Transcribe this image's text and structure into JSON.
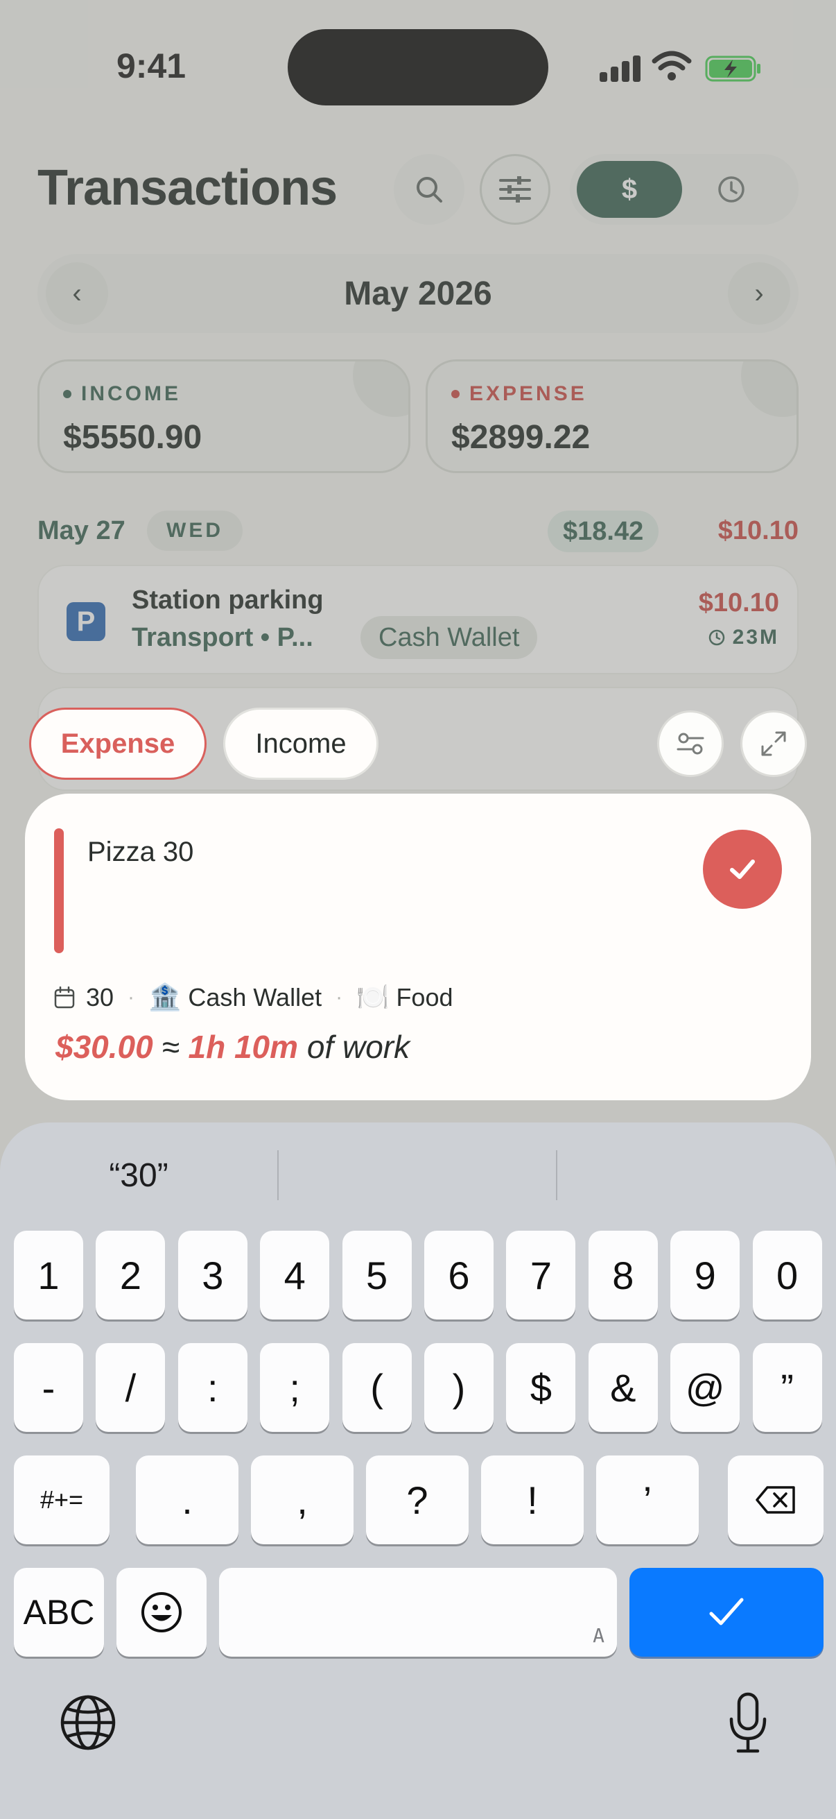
{
  "status_bar": {
    "time": "9:41"
  },
  "header": {
    "title": "Transactions",
    "currency_symbol": "$"
  },
  "month_nav": {
    "label": "May 2026",
    "prev": "‹",
    "next": "›"
  },
  "summary": {
    "income": {
      "label": "INCOME",
      "value": "$5550.90",
      "color": "#2f5b4b"
    },
    "expense": {
      "label": "EXPENSE",
      "value": "$2899.22",
      "color": "#c8423d"
    }
  },
  "day_group": {
    "date": "May 27",
    "weekday": "WED",
    "income_total": "$18.42",
    "expense_total": "$10.10"
  },
  "transactions": [
    {
      "icon_letter": "P",
      "title": "Station parking",
      "subtitle": "Transport • P...",
      "wallet": "Cash Wallet",
      "amount": "$10.10",
      "elapsed": "23M"
    }
  ],
  "composer": {
    "type_expense": "Expense",
    "type_income": "Income",
    "input_text": "Pizza 30",
    "date_value": "30",
    "wallet_emoji": "🏦",
    "wallet": "Cash Wallet",
    "category_emoji": "🍽️",
    "category": "Food",
    "amount": "$30.00",
    "approx": "≈",
    "work_time": "1h 10m",
    "work_suffix": "of work",
    "accent_color": "#dc5f5b"
  },
  "keyboard": {
    "suggestion": "“30”",
    "row1": [
      "1",
      "2",
      "3",
      "4",
      "5",
      "6",
      "7",
      "8",
      "9",
      "0"
    ],
    "row2": [
      "-",
      "/",
      ":",
      ";",
      "(",
      ")",
      "$",
      "&",
      "@",
      "”"
    ],
    "row3": [
      ".",
      ",",
      "?",
      "!",
      "’"
    ],
    "symbols_key": "#+=",
    "abc_key": "ABC",
    "space_hint": "A",
    "done_color": "#0a7aff"
  }
}
